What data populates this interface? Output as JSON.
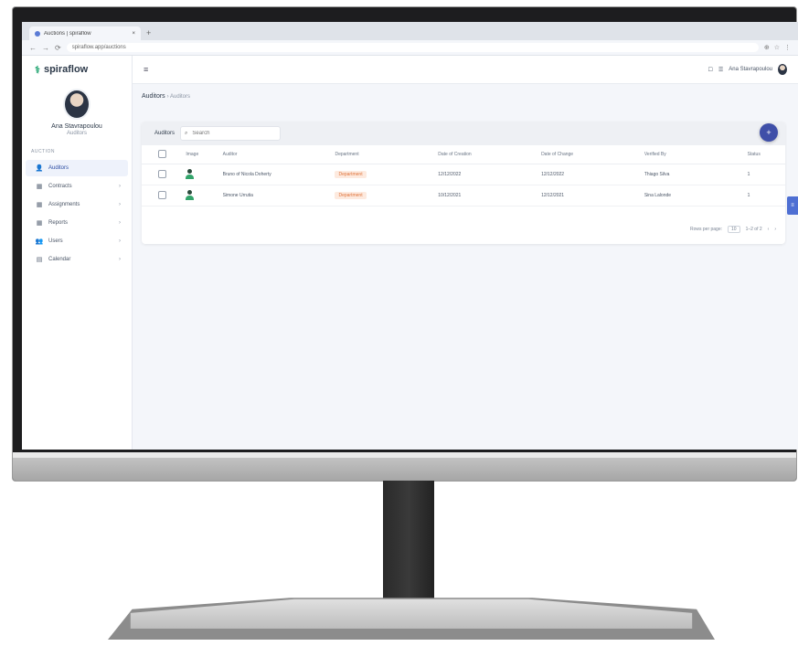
{
  "browser": {
    "tab_title": "Auctions | spiraflow",
    "new_tab": "+",
    "url": "spiraflow.app/auctions",
    "nav": {
      "back": "←",
      "forward": "→",
      "reload": "⟳"
    }
  },
  "brand": {
    "logo_glyph": "⚕",
    "name": "spiraflow"
  },
  "profile": {
    "name": "Ana Stavrapoulou",
    "role": "Auditors"
  },
  "sidebar": {
    "heading": "AUCTION",
    "items": [
      {
        "label": "Auditors",
        "icon": "user-icon",
        "glyph": "👤",
        "active": true,
        "has_chevron": false
      },
      {
        "label": "Contracts",
        "icon": "grid-icon",
        "glyph": "▦",
        "active": false,
        "has_chevron": true
      },
      {
        "label": "Assignments",
        "icon": "grid-icon",
        "glyph": "▦",
        "active": false,
        "has_chevron": true
      },
      {
        "label": "Reports",
        "icon": "grid-icon",
        "glyph": "▦",
        "active": false,
        "has_chevron": true
      },
      {
        "label": "Users",
        "icon": "users-icon",
        "glyph": "👥",
        "active": false,
        "has_chevron": true
      },
      {
        "label": "Calendar",
        "icon": "calendar-icon",
        "glyph": "▤",
        "active": false,
        "has_chevron": true
      }
    ]
  },
  "topbar": {
    "menu_glyph": "≡",
    "user_name": "Ana Stavrapoulou",
    "settings_glyph": "☐",
    "lang_glyph": "☰"
  },
  "breadcrumb": {
    "title": "Auditors",
    "sub": "› Auditors"
  },
  "card": {
    "title": "Auditors",
    "search_placeholder": "Search",
    "search_value": "",
    "add_glyph": "+",
    "columns": [
      "",
      "Image",
      "Auditor",
      "Department",
      "Date of Creation",
      "Date of Change",
      "Verified By",
      "Status"
    ],
    "rows": [
      {
        "auditor": "Bruno of Nicola Doherty",
        "department": "Department",
        "created": "12/12/2022",
        "changed": "12/12/2022",
        "verified": "Thiago Silva",
        "status": "1"
      },
      {
        "auditor": "Simone Urrutia",
        "department": "Department",
        "created": "10/12/2021",
        "changed": "12/12/2021",
        "verified": "Sina Lalonde",
        "status": "1"
      }
    ],
    "pager": {
      "rows_label": "Rows per page:",
      "rows_value": "10",
      "range": "1–2 of 2",
      "prev": "‹",
      "next": "›"
    }
  },
  "side_tab_glyph": "≡",
  "colors": {
    "accent": "#3f4fa8",
    "brand": "#2aa876",
    "badge_bg": "#fdeadf",
    "badge_text": "#e0743b"
  }
}
